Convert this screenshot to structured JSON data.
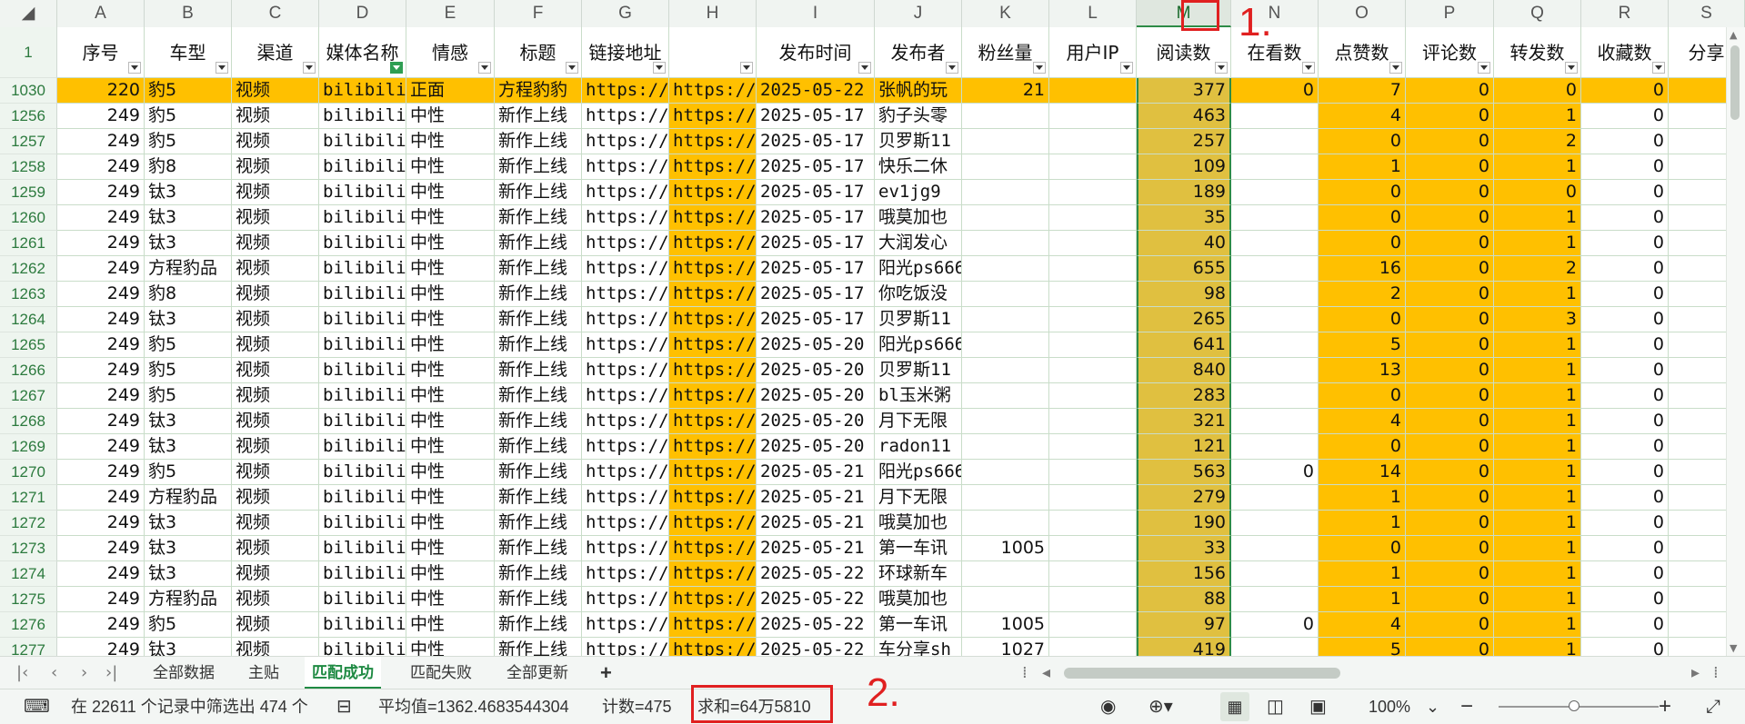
{
  "columns": [
    "A",
    "B",
    "C",
    "D",
    "E",
    "F",
    "G",
    "H",
    "I",
    "J",
    "K",
    "L",
    "M",
    "N",
    "O",
    "P",
    "Q",
    "R",
    "S"
  ],
  "header_row_number": "1",
  "headers": [
    "序号",
    "车型",
    "渠道",
    "媒体名称",
    "情感",
    "标题",
    "链接地址",
    "",
    "发布时间",
    "发布者",
    "粉丝量",
    "用户IP",
    "阅读数",
    "在看数",
    "点赞数",
    "评论数",
    "转发数",
    "收藏数",
    "分享"
  ],
  "rows": [
    {
      "rn": "1030",
      "A": "220",
      "B": "豹5",
      "C": "视频",
      "D": "bilibili",
      "E": "正面",
      "F": "方程豹豹",
      "G": "https://w",
      "H": "https://w",
      "I": "2025-05-22",
      "J": "张帆的玩",
      "K": "21",
      "L": "",
      "M": "377",
      "N": "0",
      "O": "7",
      "P": "0",
      "Q": "0",
      "R": "0"
    },
    {
      "rn": "1256",
      "A": "249",
      "B": "豹5",
      "C": "视频",
      "D": "bilibili",
      "E": "中性",
      "F": "新作上线",
      "G": "https://w",
      "H": "https://w",
      "I": "2025-05-17",
      "J": "豹子头零",
      "K": "",
      "L": "",
      "M": "463",
      "N": "",
      "O": "4",
      "P": "0",
      "Q": "1",
      "R": "0"
    },
    {
      "rn": "1257",
      "A": "249",
      "B": "豹5",
      "C": "视频",
      "D": "bilibili",
      "E": "中性",
      "F": "新作上线",
      "G": "https://w",
      "H": "https://w",
      "I": "2025-05-17",
      "J": "贝罗斯11",
      "K": "",
      "L": "",
      "M": "257",
      "N": "",
      "O": "0",
      "P": "0",
      "Q": "2",
      "R": "0"
    },
    {
      "rn": "1258",
      "A": "249",
      "B": "豹8",
      "C": "视频",
      "D": "bilibili",
      "E": "中性",
      "F": "新作上线",
      "G": "https://w",
      "H": "https://w",
      "I": "2025-05-17",
      "J": "快乐二休",
      "K": "",
      "L": "",
      "M": "109",
      "N": "",
      "O": "1",
      "P": "0",
      "Q": "1",
      "R": "0"
    },
    {
      "rn": "1259",
      "A": "249",
      "B": "钛3",
      "C": "视频",
      "D": "bilibili",
      "E": "中性",
      "F": "新作上线",
      "G": "https://w",
      "H": "https://w",
      "I": "2025-05-17",
      "J": "ev1jg9",
      "K": "",
      "L": "",
      "M": "189",
      "N": "",
      "O": "0",
      "P": "0",
      "Q": "0",
      "R": "0"
    },
    {
      "rn": "1260",
      "A": "249",
      "B": "钛3",
      "C": "视频",
      "D": "bilibili",
      "E": "中性",
      "F": "新作上线",
      "G": "https://w",
      "H": "https://w",
      "I": "2025-05-17",
      "J": "哦莫加也",
      "K": "",
      "L": "",
      "M": "35",
      "N": "",
      "O": "0",
      "P": "0",
      "Q": "1",
      "R": "0"
    },
    {
      "rn": "1261",
      "A": "249",
      "B": "钛3",
      "C": "视频",
      "D": "bilibili",
      "E": "中性",
      "F": "新作上线",
      "G": "https://w",
      "H": "https://w",
      "I": "2025-05-17",
      "J": "大润发心",
      "K": "",
      "L": "",
      "M": "40",
      "N": "",
      "O": "0",
      "P": "0",
      "Q": "1",
      "R": "0"
    },
    {
      "rn": "1262",
      "A": "249",
      "B": "方程豹品",
      "C": "视频",
      "D": "bilibili",
      "E": "中性",
      "F": "新作上线",
      "G": "https://w",
      "H": "https://w",
      "I": "2025-05-17",
      "J": "阳光ps666",
      "K": "",
      "L": "",
      "M": "655",
      "N": "",
      "O": "16",
      "P": "0",
      "Q": "2",
      "R": "0"
    },
    {
      "rn": "1263",
      "A": "249",
      "B": "豹8",
      "C": "视频",
      "D": "bilibili",
      "E": "中性",
      "F": "新作上线",
      "G": "https://w",
      "H": "https://w",
      "I": "2025-05-17",
      "J": "你吃饭没",
      "K": "",
      "L": "",
      "M": "98",
      "N": "",
      "O": "2",
      "P": "0",
      "Q": "1",
      "R": "0"
    },
    {
      "rn": "1264",
      "A": "249",
      "B": "钛3",
      "C": "视频",
      "D": "bilibili",
      "E": "中性",
      "F": "新作上线",
      "G": "https://w",
      "H": "https://w",
      "I": "2025-05-17",
      "J": "贝罗斯11",
      "K": "",
      "L": "",
      "M": "265",
      "N": "",
      "O": "0",
      "P": "0",
      "Q": "3",
      "R": "0"
    },
    {
      "rn": "1265",
      "A": "249",
      "B": "豹5",
      "C": "视频",
      "D": "bilibili",
      "E": "中性",
      "F": "新作上线",
      "G": "https://w",
      "H": "https://w",
      "I": "2025-05-20",
      "J": "阳光ps666",
      "K": "",
      "L": "",
      "M": "641",
      "N": "",
      "O": "5",
      "P": "0",
      "Q": "1",
      "R": "0"
    },
    {
      "rn": "1266",
      "A": "249",
      "B": "豹5",
      "C": "视频",
      "D": "bilibili",
      "E": "中性",
      "F": "新作上线",
      "G": "https://w",
      "H": "https://w",
      "I": "2025-05-20",
      "J": "贝罗斯11",
      "K": "",
      "L": "",
      "M": "840",
      "N": "",
      "O": "13",
      "P": "0",
      "Q": "1",
      "R": "0"
    },
    {
      "rn": "1267",
      "A": "249",
      "B": "豹5",
      "C": "视频",
      "D": "bilibili",
      "E": "中性",
      "F": "新作上线",
      "G": "https://w",
      "H": "https://w",
      "I": "2025-05-20",
      "J": "bl玉米粥",
      "K": "",
      "L": "",
      "M": "283",
      "N": "",
      "O": "0",
      "P": "0",
      "Q": "1",
      "R": "0"
    },
    {
      "rn": "1268",
      "A": "249",
      "B": "钛3",
      "C": "视频",
      "D": "bilibili",
      "E": "中性",
      "F": "新作上线",
      "G": "https://w",
      "H": "https://w",
      "I": "2025-05-20",
      "J": "月下无限",
      "K": "",
      "L": "",
      "M": "321",
      "N": "",
      "O": "4",
      "P": "0",
      "Q": "1",
      "R": "0"
    },
    {
      "rn": "1269",
      "A": "249",
      "B": "钛3",
      "C": "视频",
      "D": "bilibili",
      "E": "中性",
      "F": "新作上线",
      "G": "https://w",
      "H": "https://w",
      "I": "2025-05-20",
      "J": "radon11",
      "K": "",
      "L": "",
      "M": "121",
      "N": "",
      "O": "0",
      "P": "0",
      "Q": "1",
      "R": "0"
    },
    {
      "rn": "1270",
      "A": "249",
      "B": "豹5",
      "C": "视频",
      "D": "bilibili",
      "E": "中性",
      "F": "新作上线",
      "G": "https://w",
      "H": "https://w",
      "I": "2025-05-21",
      "J": "阳光ps666",
      "K": "",
      "L": "",
      "M": "563",
      "N": "0",
      "O": "14",
      "P": "0",
      "Q": "1",
      "R": "0"
    },
    {
      "rn": "1271",
      "A": "249",
      "B": "方程豹品",
      "C": "视频",
      "D": "bilibili",
      "E": "中性",
      "F": "新作上线",
      "G": "https://w",
      "H": "https://w",
      "I": "2025-05-21",
      "J": "月下无限",
      "K": "",
      "L": "",
      "M": "279",
      "N": "",
      "O": "1",
      "P": "0",
      "Q": "1",
      "R": "0"
    },
    {
      "rn": "1272",
      "A": "249",
      "B": "钛3",
      "C": "视频",
      "D": "bilibili",
      "E": "中性",
      "F": "新作上线",
      "G": "https://w",
      "H": "https://w",
      "I": "2025-05-21",
      "J": "哦莫加也",
      "K": "",
      "L": "",
      "M": "190",
      "N": "",
      "O": "1",
      "P": "0",
      "Q": "1",
      "R": "0"
    },
    {
      "rn": "1273",
      "A": "249",
      "B": "钛3",
      "C": "视频",
      "D": "bilibili",
      "E": "中性",
      "F": "新作上线",
      "G": "https://w",
      "H": "https://w",
      "I": "2025-05-21",
      "J": "第一车讯",
      "K": "1005",
      "L": "",
      "M": "33",
      "N": "",
      "O": "0",
      "P": "0",
      "Q": "1",
      "R": "0"
    },
    {
      "rn": "1274",
      "A": "249",
      "B": "钛3",
      "C": "视频",
      "D": "bilibili",
      "E": "中性",
      "F": "新作上线",
      "G": "https://w",
      "H": "https://w",
      "I": "2025-05-22",
      "J": "环球新车",
      "K": "",
      "L": "",
      "M": "156",
      "N": "",
      "O": "1",
      "P": "0",
      "Q": "1",
      "R": "0"
    },
    {
      "rn": "1275",
      "A": "249",
      "B": "方程豹品",
      "C": "视频",
      "D": "bilibili",
      "E": "中性",
      "F": "新作上线",
      "G": "https://w",
      "H": "https://w",
      "I": "2025-05-22",
      "J": "哦莫加也",
      "K": "",
      "L": "",
      "M": "88",
      "N": "",
      "O": "1",
      "P": "0",
      "Q": "1",
      "R": "0"
    },
    {
      "rn": "1276",
      "A": "249",
      "B": "豹5",
      "C": "视频",
      "D": "bilibili",
      "E": "中性",
      "F": "新作上线",
      "G": "https://w",
      "H": "https://w",
      "I": "2025-05-22",
      "J": "第一车讯",
      "K": "1005",
      "L": "",
      "M": "97",
      "N": "0",
      "O": "4",
      "P": "0",
      "Q": "1",
      "R": "0"
    },
    {
      "rn": "1277",
      "A": "249",
      "B": "钛3",
      "C": "视频",
      "D": "bilibili",
      "E": "中性",
      "F": "新作上线",
      "G": "https://w",
      "H": "https://w",
      "I": "2025-05-22",
      "J": "车分享sh",
      "K": "1027",
      "L": "",
      "M": "419",
      "N": "",
      "O": "5",
      "P": "0",
      "Q": "1",
      "R": "0"
    }
  ],
  "annotations": {
    "label1": "1.",
    "label2": "2."
  },
  "sheet_tabs": [
    "全部数据",
    "主贴",
    "匹配成功",
    "匹配失败",
    "全部更新"
  ],
  "active_tab": "匹配成功",
  "add_tab_label": "+",
  "status": {
    "filter_text": "在 22611 个记录中筛选出 474 个",
    "average": "平均值=1362.4683544304",
    "count": "计数=475",
    "sum": "求和=64万5810",
    "zoom": "100%"
  },
  "colors": {
    "highlight_row": "#ffc000",
    "highlight_col": "#ffc000",
    "selected_col": "#e0c040",
    "annotation": "#e02020",
    "accent_green": "#1f8a43"
  }
}
